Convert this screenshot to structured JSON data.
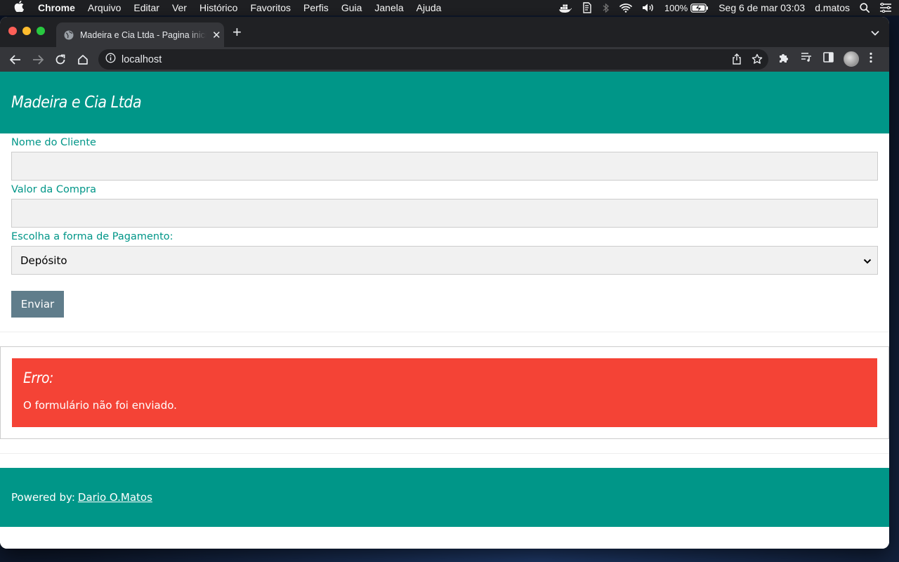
{
  "menubar": {
    "app": "Chrome",
    "items": [
      "Arquivo",
      "Editar",
      "Ver",
      "Histórico",
      "Favoritos",
      "Perfis",
      "Guia",
      "Janela",
      "Ajuda"
    ],
    "battery": "100%",
    "datetime": "Seg 6 de mar  03:03",
    "user": "d.matos"
  },
  "browser": {
    "tab_title": "Madeira e Cia Ltda - Pagina inicial",
    "url": "localhost"
  },
  "site": {
    "title": "Madeira e Cia Ltda"
  },
  "form": {
    "name_label": "Nome do Cliente",
    "name_value": "",
    "amount_label": "Valor da Compra",
    "amount_value": "",
    "payment_label": "Escolha a forma de Pagamento:",
    "payment_selected": "Depósito",
    "submit_label": "Enviar"
  },
  "error": {
    "title": "Erro:",
    "message": "O formulário não foi enviado."
  },
  "footer": {
    "prefix": "Powered by:",
    "author_link": "Dario O.Matos"
  },
  "colors": {
    "primary": "#009688",
    "error": "#f44336",
    "button": "#607d8b"
  }
}
